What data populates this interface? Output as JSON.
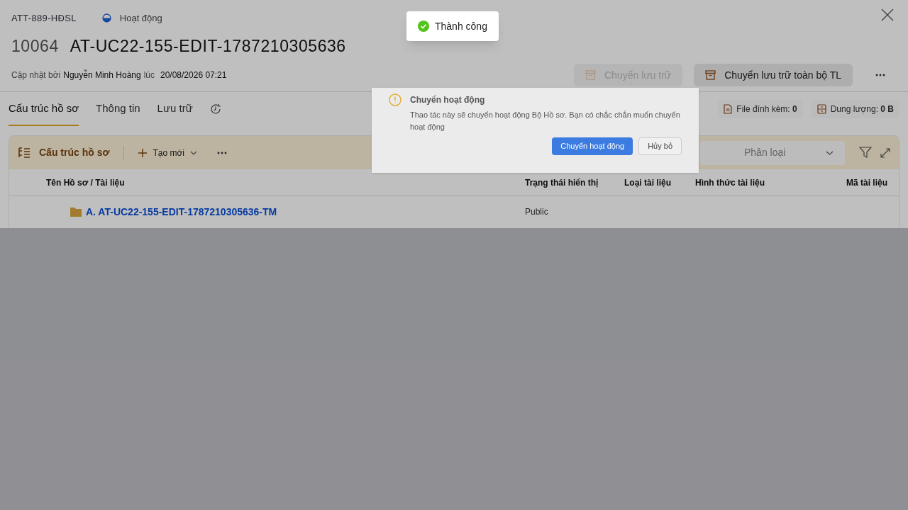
{
  "header": {
    "code": "ATT-889-HĐSL",
    "status": {
      "label": "Hoạt động",
      "active": true
    },
    "number": "10064",
    "title": "AT-UC22-155-EDIT-1787210305636",
    "updated_label": "Cập nhật bởi",
    "updated_by": "Nguyễn Minh Hoàng",
    "at_label": "lúc",
    "updated_at": "20/08/2026 07:21"
  },
  "actions": [
    {
      "label": "Chuyển lưu trữ",
      "disabled": true
    },
    {
      "label": "Chuyển lưu trữ toàn bộ TL",
      "disabled": false
    }
  ],
  "tabs": [
    {
      "label": "Cấu trúc hồ sơ",
      "selected": true
    },
    {
      "label": "Thông tin",
      "selected": false
    },
    {
      "label": "Lưu trữ",
      "selected": false
    }
  ],
  "stats": [
    {
      "kind": "file",
      "label": "File đính kèm:",
      "value": "0"
    },
    {
      "kind": "storage",
      "label": "Dung lượng:",
      "value": "0 B"
    }
  ],
  "panel": {
    "title": "Cấu trúc hồ sơ",
    "new_button": "Tạo mới",
    "category_select": {
      "placeholder": "Phân loại"
    }
  },
  "table": {
    "columns": [
      "Tên Hồ sơ / Tài liệu",
      "Trạng thái hiển thị",
      "Loại tài liệu",
      "Hình thức tài liệu",
      "Mã tài liệu"
    ],
    "rows": [
      {
        "kind": "folder",
        "name": "A. AT-UC22-155-EDIT-1787210305636-TM",
        "visibility": "Public"
      }
    ]
  },
  "toast": {
    "kind": "success",
    "message": "Thành công"
  },
  "dialog": {
    "title": "Chuyển hoạt động",
    "message": "Thao tác này sẽ chuyển hoạt động Bộ Hồ sơ. Bạn có chắc chắn muốn chuyển hoạt động",
    "buttons": [
      {
        "label": "Chuyển hoạt động",
        "primary": true
      },
      {
        "label": "Hủy bỏ",
        "primary": false
      }
    ]
  }
}
